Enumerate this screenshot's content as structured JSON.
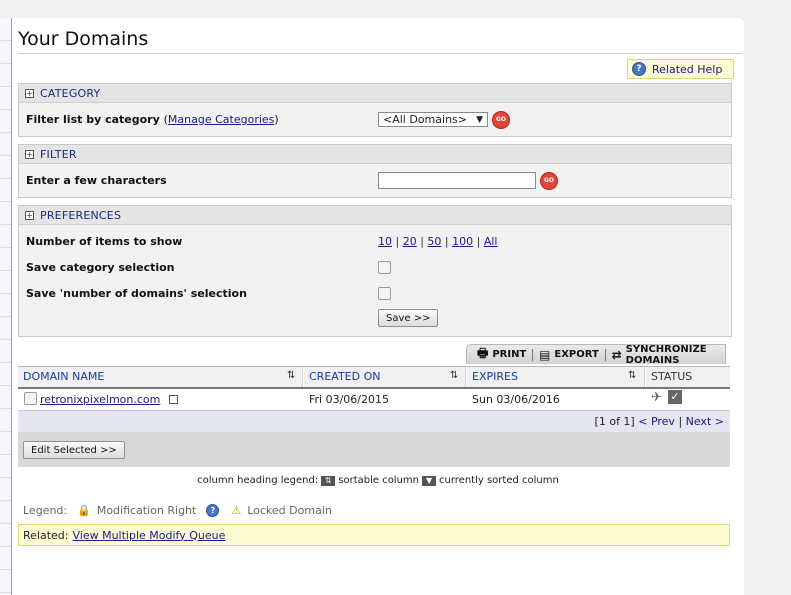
{
  "page": {
    "title": "Your Domains",
    "related_help": "Related Help"
  },
  "category": {
    "header": "CATEGORY",
    "filter_label": "Filter list by category",
    "manage_link": "Manage Categories",
    "selected": "<All Domains>"
  },
  "filter": {
    "header": "FILTER",
    "label": "Enter a few characters",
    "value": ""
  },
  "preferences": {
    "header": "PREFERENCES",
    "items_label": "Number of items to show",
    "sizes": [
      "10",
      "20",
      "50",
      "100",
      "All"
    ],
    "save_category_label": "Save category selection",
    "save_number_label": "Save 'number of domains' selection",
    "save_button": "Save >>"
  },
  "tabs": {
    "print": "PRINT",
    "export": "EXPORT",
    "sync": "SYNCHRONIZE DOMAINS"
  },
  "table": {
    "columns": [
      "DOMAIN NAME",
      "CREATED ON",
      "EXPIRES",
      "STATUS"
    ],
    "rows": [
      {
        "domain": "retronixpixelmon.com",
        "created": "Fri 03/06/2015",
        "expires": "Sun 03/06/2016"
      }
    ],
    "pager": {
      "info": "[1 of 1]",
      "prev": "< Prev",
      "next": "Next >"
    },
    "edit_button": "Edit Selected >>"
  },
  "legend": {
    "column_heading": "column heading legend:",
    "sortable": "sortable column",
    "sorted": "currently sorted column",
    "label": "Legend:",
    "modification": "Modification Right",
    "locked": "Locked Domain"
  },
  "related": {
    "label": "Related:",
    "link": "View Multiple Modify Queue"
  },
  "colors": {
    "link": "#1a1a8a",
    "header_text": "#1a2a80",
    "go_button": "#e0443a",
    "help_bg": "#fdfbd2"
  }
}
